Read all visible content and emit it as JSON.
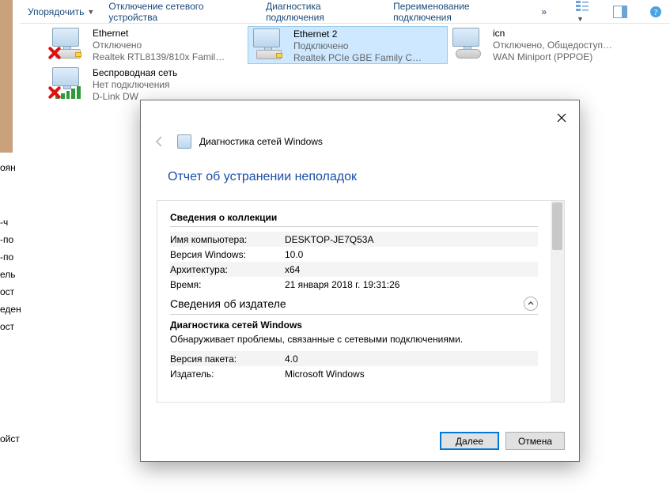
{
  "toolbar": {
    "organize": "Упорядочить",
    "disable_device": "Отключение сетевого устройства",
    "diagnose": "Диагностика подключения",
    "rename": "Переименование подключения",
    "more": "»"
  },
  "adapters": [
    {
      "name": "Ethernet",
      "status": "Отключено",
      "device": "Realtek RTL8139/810x Famil…",
      "type": "eth",
      "cross": true,
      "selected": false
    },
    {
      "name": "Ethernet 2",
      "status": "Подключено",
      "device": "Realtek PCIe GBE Family C…",
      "type": "eth",
      "cross": false,
      "selected": true
    },
    {
      "name": "icn",
      "status": "Отключено, Общедоступ…",
      "device": "WAN Miniport (PPPOE)",
      "type": "dial",
      "cross": false,
      "selected": false
    },
    {
      "name": "Беспроводная сеть",
      "status": "Нет подключения",
      "device": "D-Link DW",
      "type": "wifi",
      "cross": true,
      "selected": false
    }
  ],
  "dialog": {
    "title": "Диагностика сетей Windows",
    "heading": "Отчет об устранении неполадок",
    "sections": {
      "collection": {
        "title": "Сведения о коллекции",
        "rows": [
          {
            "k": "Имя компьютера:",
            "v": "DESKTOP-JE7Q53A"
          },
          {
            "k": "Версия Windows:",
            "v": "10.0"
          },
          {
            "k": "Архитектура:",
            "v": "x64"
          },
          {
            "k": "Время:",
            "v": "21 января 2018 г. 19:31:26"
          }
        ]
      },
      "publisher": {
        "title": "Сведения об издателе",
        "sub_title": "Диагностика сетей Windows",
        "desc": "Обнаруживает проблемы, связанные с сетевыми подключениями.",
        "rows": [
          {
            "k": "Версия пакета:",
            "v": "4.0"
          },
          {
            "k": "Издатель:",
            "v": "Microsoft Windows"
          }
        ]
      }
    },
    "buttons": {
      "next": "Далее",
      "cancel": "Отмена"
    }
  },
  "sidebar_fragments": {
    "a": "оян",
    "items": [
      "-ч",
      "-по",
      "-по",
      "ель",
      "ост",
      "",
      "еден",
      "ост",
      "",
      "",
      "",
      "ойст",
      ""
    ]
  }
}
